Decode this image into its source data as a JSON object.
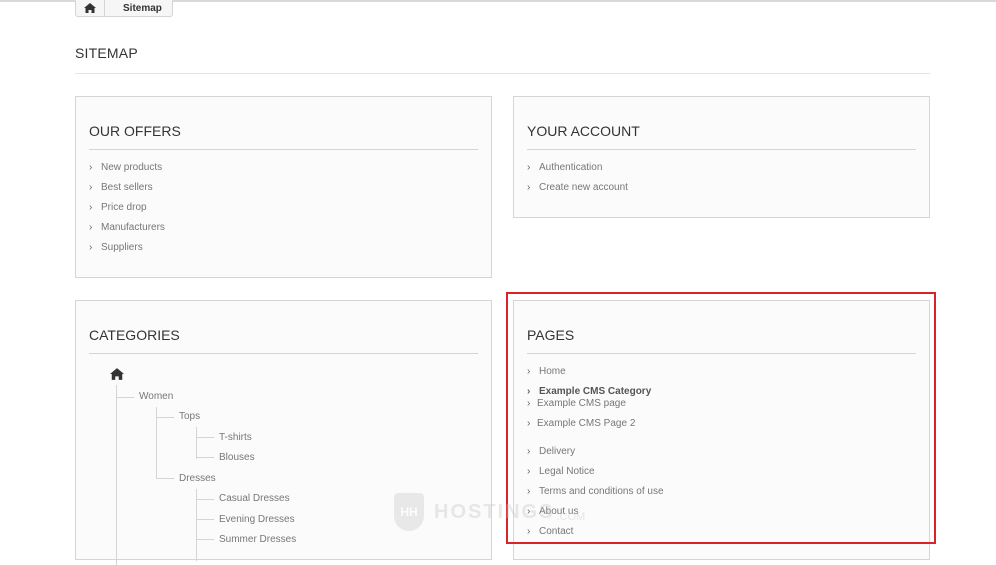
{
  "breadcrumb": {
    "current": "Sitemap"
  },
  "page": {
    "title": "SITEMAP"
  },
  "offers": {
    "title": "OUR OFFERS",
    "items": [
      "New products",
      "Best sellers",
      "Price drop",
      "Manufacturers",
      "Suppliers"
    ]
  },
  "account": {
    "title": "YOUR ACCOUNT",
    "items": [
      "Authentication",
      "Create new account"
    ]
  },
  "categories": {
    "title": "CATEGORIES",
    "tree": {
      "women": "Women",
      "tops": "Tops",
      "tshirts": "T-shirts",
      "blouses": "Blouses",
      "dresses": "Dresses",
      "casual": "Casual Dresses",
      "evening": "Evening Dresses",
      "summer": "Summer Dresses"
    }
  },
  "pages": {
    "title": "PAGES",
    "home": "Home",
    "cms_category": "Example CMS Category",
    "cms_page": "Example CMS page",
    "cms_page_2": "Example CMS Page 2",
    "delivery": "Delivery",
    "legal": "Legal Notice",
    "terms": "Terms and conditions of use",
    "about": "About us",
    "contact": "Contact"
  },
  "watermark": {
    "brand": "HOSTINGS",
    "domain": ".COM",
    "badge": "HH"
  },
  "colors": {
    "highlight": "#d9232b",
    "border": "#d6d4d4",
    "text": "#777777"
  }
}
